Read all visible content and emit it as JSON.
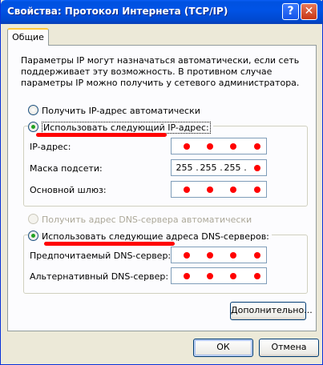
{
  "window": {
    "title": "Свойства: Протокол Интернета (TCP/IP)",
    "help_glyph": "?",
    "close_glyph": "✕"
  },
  "tabs": [
    {
      "label": "Общие"
    }
  ],
  "description": "Параметры IP могут назначаться автоматически, если сеть поддерживает эту возможность. В противном случае параметры IP можно получить у сетевого администратора.",
  "ip_mode": {
    "auto_label": "Получить IP-адрес автоматически",
    "manual_label": "Использовать следующий IP-адрес:",
    "selected": "manual"
  },
  "ip_fields": {
    "ip_address_label": "IP-адрес:",
    "subnet_label": "Маска подсети:",
    "gateway_label": "Основной шлюз:",
    "subnet_value": [
      "255",
      "255",
      "255",
      ""
    ]
  },
  "dns_mode": {
    "auto_label": "Получить адрес DNS-сервера автоматически",
    "manual_label": "Использовать следующие адреса DNS-серверов:",
    "selected": "manual",
    "auto_disabled": true
  },
  "dns_fields": {
    "preferred_label": "Предпочитаемый DNS-сервер:",
    "alternate_label": "Альтернативный DNS-сервер:"
  },
  "buttons": {
    "advanced": "Дополнительно...",
    "ok": "ОК",
    "cancel": "Отмена"
  },
  "redaction_color": "#ff0000",
  "ip_separator": "."
}
